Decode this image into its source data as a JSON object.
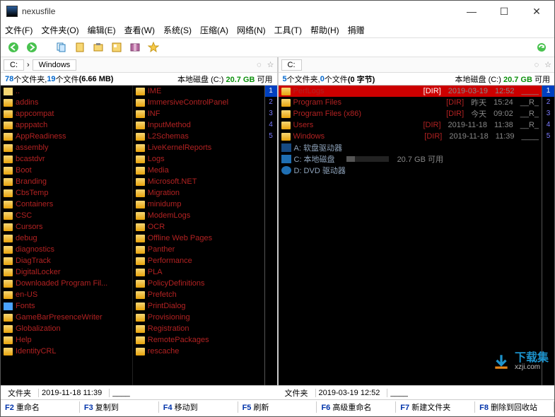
{
  "window": {
    "title": "nexusfile"
  },
  "menu": [
    "文件(F)",
    "文件夹(O)",
    "编辑(E)",
    "查看(W)",
    "系统(S)",
    "压缩(A)",
    "网络(N)",
    "工具(T)",
    "帮助(H)",
    "捐赠"
  ],
  "left": {
    "path": [
      "C:",
      "Windows"
    ],
    "summary": {
      "folders": "78",
      "folders_suffix": " 个文件夹, ",
      "files": "19",
      "files_suffix": " 个文件 ",
      "size": "(6.66 MB)",
      "disk_label": "本地磁盘 (C:) ",
      "free": "20.7 GB",
      "free_suffix": " 可用"
    },
    "colA": [
      "..",
      "addins",
      "appcompat",
      "apppatch",
      "AppReadiness",
      "assembly",
      "bcastdvr",
      "Boot",
      "Branding",
      "CbsTemp",
      "Containers",
      "CSC",
      "Cursors",
      "debug",
      "diagnostics",
      "DiagTrack",
      "DigitalLocker",
      "Downloaded Program Fil...",
      "en-US",
      "Fonts",
      "GameBarPresenceWriter",
      "Globalization",
      "Help",
      "IdentityCRL"
    ],
    "colB": [
      "IME",
      "ImmersiveControlPanel",
      "INF",
      "InputMethod",
      "L2Schemas",
      "LiveKernelReports",
      "Logs",
      "Media",
      "Microsoft.NET",
      "Migration",
      "minidump",
      "ModemLogs",
      "OCR",
      "Offline Web Pages",
      "Panther",
      "Performance",
      "PLA",
      "PolicyDefinitions",
      "Prefetch",
      "PrintDialog",
      "Provisioning",
      "Registration",
      "RemotePackages",
      "rescache"
    ],
    "status": {
      "type": "文件夹",
      "date": "2019-11-18 11:39",
      "attrs": "____"
    }
  },
  "right": {
    "path": [
      "C:"
    ],
    "summary": {
      "folders": "5",
      "folders_suffix": " 个文件夹, ",
      "files": "0",
      "files_suffix": " 个文件 ",
      "size": "(0 字节)",
      "disk_label": "本地磁盘 (C:) ",
      "free": "20.7 GB",
      "free_suffix": " 可用"
    },
    "items": [
      {
        "name": "PerfLogs",
        "dir": "[DIR]",
        "date": "2019-03-19",
        "time": "12:52",
        "attr": "____",
        "selected": true
      },
      {
        "name": "Program Files",
        "dir": "[DIR]",
        "date": "昨天",
        "time": "15:24",
        "attr": "__R_"
      },
      {
        "name": "Program Files (x86)",
        "dir": "[DIR]",
        "date": "今天",
        "time": "09:02",
        "attr": "__R_"
      },
      {
        "name": "Users",
        "dir": "[DIR]",
        "date": "2019-11-18",
        "time": "11:38",
        "attr": "__R_"
      },
      {
        "name": "Windows",
        "dir": "[DIR]",
        "date": "2019-11-18",
        "time": "11:39",
        "attr": "____"
      }
    ],
    "drives": [
      {
        "icon": "floppy",
        "label": "A: 软盘驱动器"
      },
      {
        "icon": "hdd",
        "label": "C: 本地磁盘",
        "free": "20.7 GB 可用",
        "usage": true
      },
      {
        "icon": "dvd",
        "label": "D: DVD 驱动器"
      }
    ],
    "status": {
      "type": "文件夹",
      "date": "2019-03-19 12:52",
      "attrs": "____"
    }
  },
  "fkeys": [
    {
      "k": "F2",
      "l": "重命名"
    },
    {
      "k": "F3",
      "l": "复制到"
    },
    {
      "k": "F4",
      "l": "移动到"
    },
    {
      "k": "F5",
      "l": "刷新"
    },
    {
      "k": "F6",
      "l": "高级重命名"
    },
    {
      "k": "F7",
      "l": "新建文件夹"
    },
    {
      "k": "F8",
      "l": "删除到回收站"
    }
  ],
  "watermark": {
    "cn": "下载集",
    "url": "xzji.com"
  }
}
